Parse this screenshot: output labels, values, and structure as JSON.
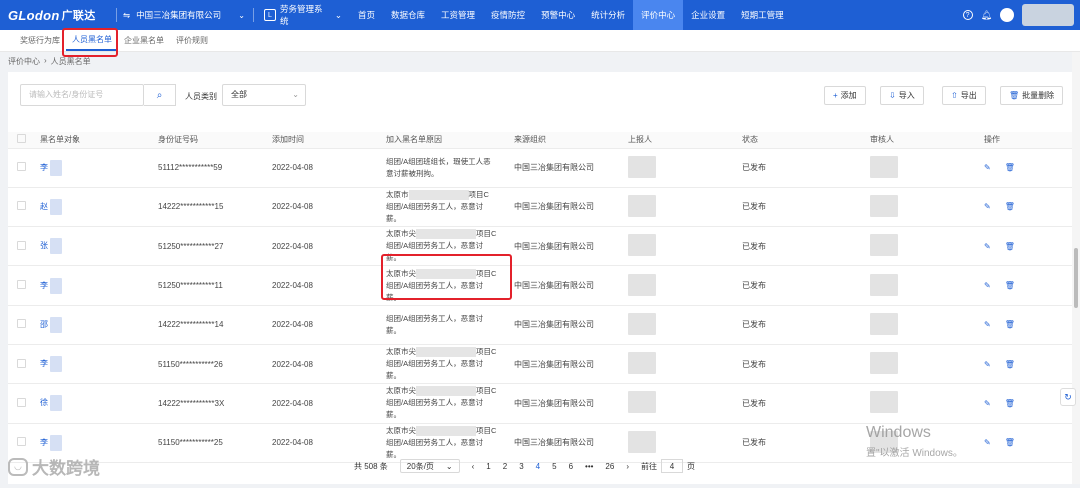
{
  "topbar": {
    "logo": "GLodon",
    "logo_cn": "广联达",
    "org": "中国三冶集团有限公司",
    "system": "劳务管理系统",
    "nav": [
      "首页",
      "数据仓库",
      "工资管理",
      "疫情防控",
      "预警中心",
      "统计分析",
      "评价中心",
      "企业设置",
      "短期工管理"
    ],
    "active_nav": 6
  },
  "tabs": [
    "奖惩行为库",
    "人员黑名单",
    "企业黑名单",
    "评价规则"
  ],
  "active_tab": 1,
  "breadcrumb": [
    "评价中心",
    "人员黑名单"
  ],
  "filters": {
    "search_placeholder": "请输入姓名/身份证号",
    "type_label": "人员类别",
    "type_value": "全部"
  },
  "actions": {
    "add": "添加",
    "import": "导入",
    "export": "导出",
    "batch_delete": "批量删除"
  },
  "columns": [
    "黑名单对象",
    "身份证号码",
    "添加时间",
    "加入黑名单原因",
    "来源组织",
    "上报人",
    "状态",
    "审核人",
    "操作"
  ],
  "rows": [
    {
      "name": "李",
      "id": "51112***********59",
      "date": "2022-04-08",
      "reason_a": "",
      "reason_b": "组团/A组团班组长，瑕使工人恶",
      "reason_c": "意讨薪被刑拘。",
      "org": "中国三冶集团有限公司",
      "status": "已发布"
    },
    {
      "name": "赵",
      "id": "14222***********15",
      "date": "2022-04-08",
      "reason_a": "太原市",
      "reason_b": "组团/A组团劳务工人，恶意讨",
      "reason_c": "薪。",
      "org": "中国三冶集团有限公司",
      "status": "已发布"
    },
    {
      "name": "张",
      "id": "51250***********27",
      "date": "2022-04-08",
      "reason_a": "太原市尖",
      "reason_b": "组团/A组团劳务工人，恶意讨",
      "reason_c": "薪。",
      "org": "中国三冶集团有限公司",
      "status": "已发布"
    },
    {
      "name": "李",
      "id": "51250***********11",
      "date": "2022-04-08",
      "reason_a": "太原市尖",
      "reason_b": "组团/A组团劳务工人，恶意讨",
      "reason_c": "薪。",
      "org": "中国三冶集团有限公司",
      "status": "已发布"
    },
    {
      "name": "邵",
      "id": "14222***********14",
      "date": "2022-04-08",
      "reason_a": "",
      "reason_b": "组团/A组团劳务工人，恶意讨",
      "reason_c": "薪。",
      "org": "中国三冶集团有限公司",
      "status": "已发布"
    },
    {
      "name": "李",
      "id": "51150***********26",
      "date": "2022-04-08",
      "reason_a": "太原市尖",
      "reason_b": "组团/A组团劳务工人，恶意讨",
      "reason_c": "薪。",
      "org": "中国三冶集团有限公司",
      "status": "已发布"
    },
    {
      "name": "徐",
      "id": "14222***********3X",
      "date": "2022-04-08",
      "reason_a": "太原市尖",
      "reason_b": "组团/A组团劳务工人，恶意讨",
      "reason_c": "薪。",
      "org": "中国三冶集团有限公司",
      "status": "已发布"
    },
    {
      "name": "李",
      "id": "51150***********25",
      "date": "2022-04-08",
      "reason_a": "太原市尖",
      "reason_b": "组团/A组团劳务工人，恶意讨",
      "reason_c": "薪。",
      "org": "中国三冶集团有限公司",
      "status": "已发布"
    }
  ],
  "reason_suffix": "项目C",
  "pagination": {
    "total": "共 508 条",
    "page_size": "20条/页",
    "pages": [
      "1",
      "2",
      "3",
      "4",
      "5",
      "6",
      "•••",
      "26"
    ],
    "active_page": 3,
    "goto_label": "前往",
    "goto_value": "4",
    "page_suffix": "页"
  },
  "watermark": "大数跨境",
  "windows_activation": {
    "line1": "Windows",
    "line2": "置\"以激活 Windows。"
  }
}
